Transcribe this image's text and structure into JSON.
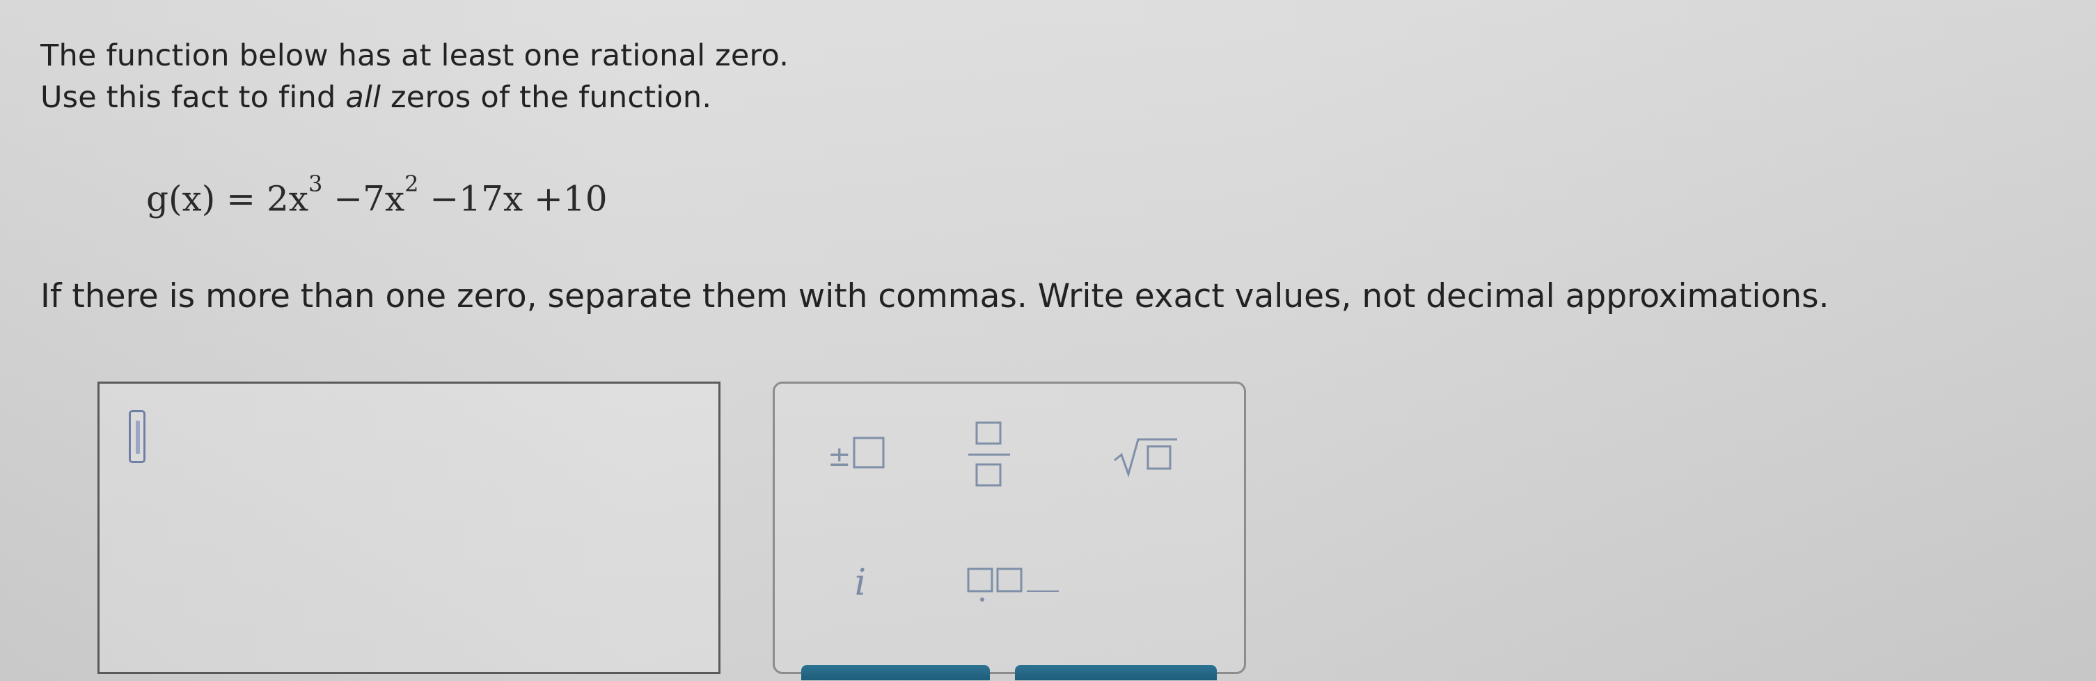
{
  "problem": {
    "line1": "The function below has at least one rational zero.",
    "line2_prefix": "Use this fact to find ",
    "line2_emphasis": "all",
    "line2_suffix": " zeros of the function."
  },
  "equation": {
    "lhs": "g(x)",
    "equals": "=",
    "term1_coef": "2x",
    "term1_exp": "3",
    "term2": "−7x",
    "term2_exp": "2",
    "term3": "−17x",
    "term4": "+10"
  },
  "instruction": "If there is more than one zero, separate them with commas. Write exact values, not decimal approximations.",
  "toolbar": {
    "imaginary_unit": "i"
  },
  "icons": {
    "plus_minus": "plus-minus-box-icon",
    "fraction": "fraction-icon",
    "sqrt": "square-root-icon",
    "blank_pair": "blank-pair-icon"
  },
  "colors": {
    "accent": "#1e5d79",
    "tool": "#7f8fa8"
  }
}
